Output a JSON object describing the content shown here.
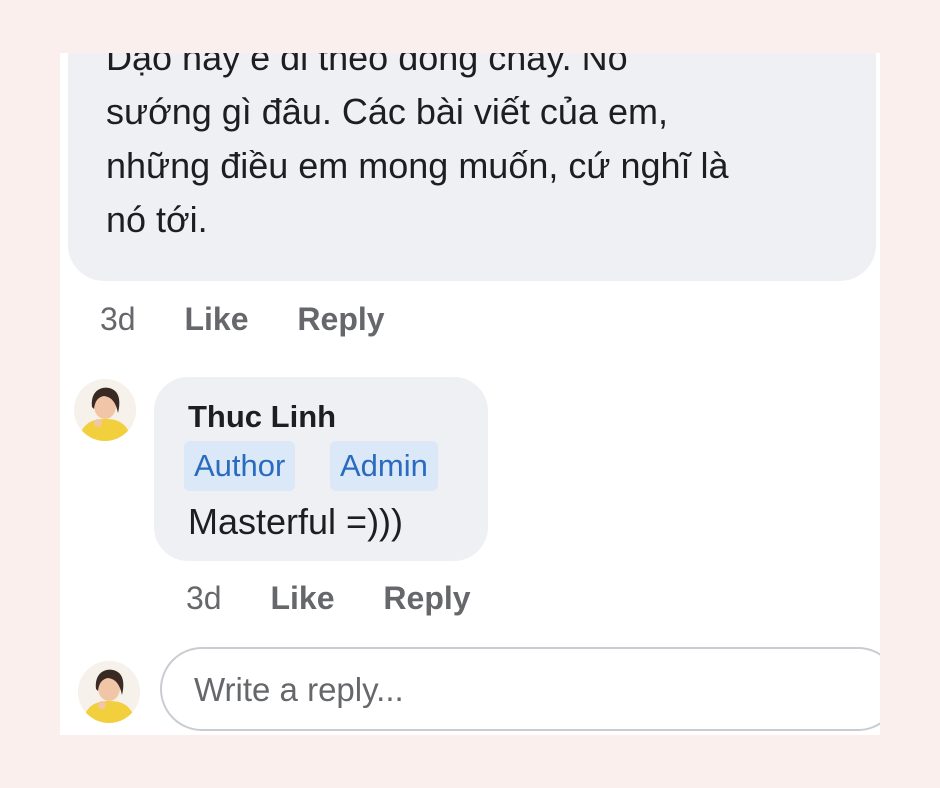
{
  "top_comment": {
    "lines": [
      "Dạo này e đi theo dòng chảy. Nó",
      "sướng gì đâu. Các bài viết của em,",
      "những điều em mong muốn, cứ nghĩ là",
      "nó tới."
    ],
    "time": "3d",
    "like_label": "Like",
    "reply_label": "Reply"
  },
  "reply": {
    "author": "Thuc Linh",
    "badges": [
      "Author",
      "Admin"
    ],
    "text": "Masterful =)))",
    "time": "3d",
    "like_label": "Like",
    "reply_label": "Reply"
  },
  "composer": {
    "placeholder": "Write a reply..."
  },
  "colors": {
    "page_background": "#fbefee",
    "bubble": "#eef0f3",
    "badge_background": "#dbe8f7",
    "badge_text": "#2a6bc0",
    "meta_text": "#65676b"
  }
}
